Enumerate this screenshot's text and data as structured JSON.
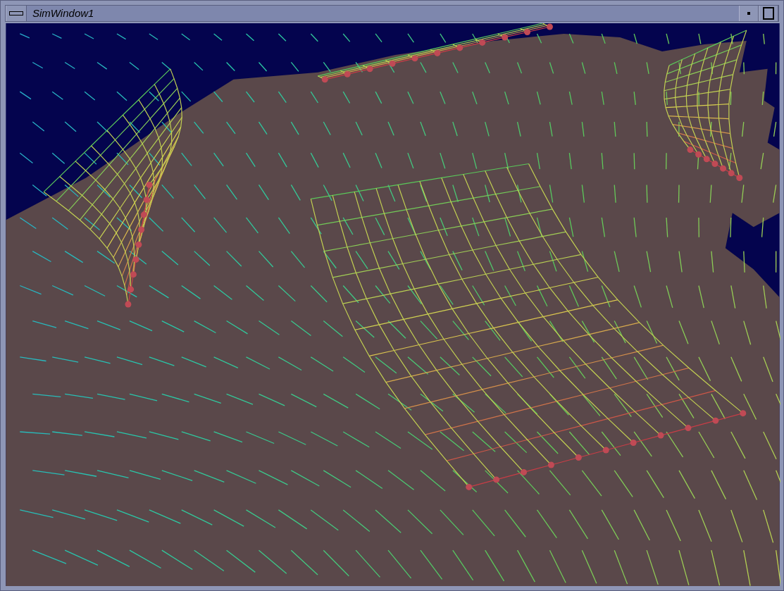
{
  "window": {
    "title": "SimWindow1"
  }
}
